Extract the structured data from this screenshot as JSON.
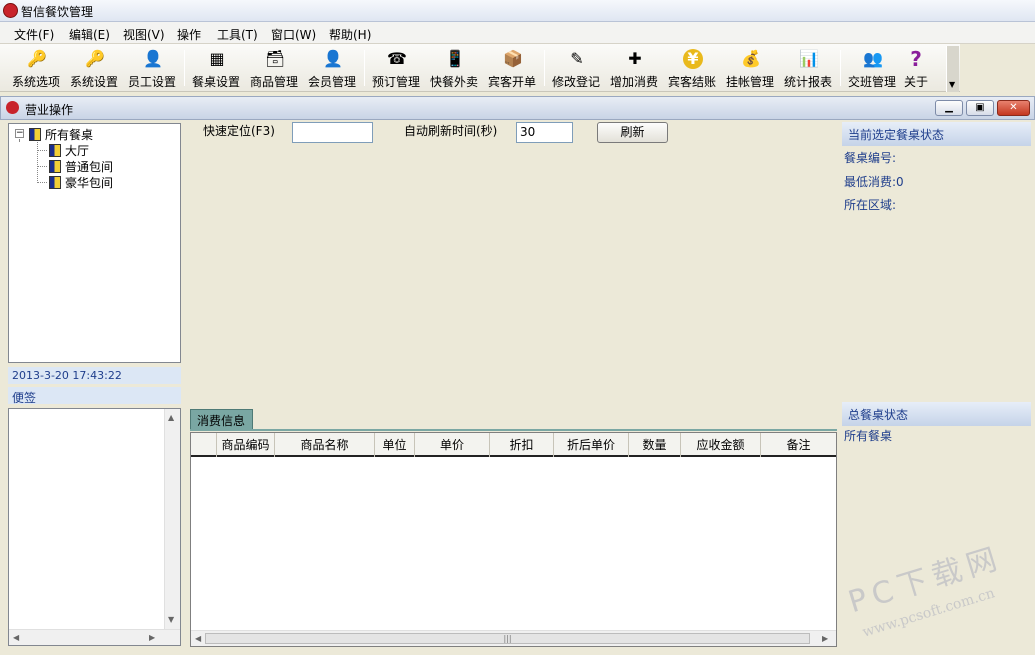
{
  "app": {
    "title": "智信餐饮管理"
  },
  "menu": [
    "文件(F)",
    "编辑(E)",
    "视图(V)",
    "操作",
    "工具(T)",
    "窗口(W)",
    "帮助(H)"
  ],
  "toolbar": [
    {
      "label": "系统选项",
      "icon": "key-icon",
      "glyph": "🔑"
    },
    {
      "label": "系统设置",
      "icon": "key-icon",
      "glyph": "🔑"
    },
    {
      "label": "员工设置",
      "icon": "user-icon",
      "glyph": "👤"
    },
    {
      "label": "餐桌设置",
      "icon": "table-icon",
      "glyph": "▦"
    },
    {
      "label": "商品管理",
      "icon": "box-icon",
      "glyph": "🗃"
    },
    {
      "label": "会员管理",
      "icon": "user-icon",
      "glyph": "👤"
    },
    {
      "label": "预订管理",
      "icon": "phone-icon",
      "glyph": "☎"
    },
    {
      "label": "快餐外卖",
      "icon": "mobile-icon",
      "glyph": "📱"
    },
    {
      "label": "宾客开单",
      "icon": "package-icon",
      "glyph": "📦"
    },
    {
      "label": "修改登记",
      "icon": "user-edit-icon",
      "glyph": "✎"
    },
    {
      "label": "增加消费",
      "icon": "add-icon",
      "glyph": "✚"
    },
    {
      "label": "宾客结账",
      "icon": "yen-icon",
      "glyph": "¥"
    },
    {
      "label": "挂帐管理",
      "icon": "moneybag-icon",
      "glyph": "💰"
    },
    {
      "label": "统计报表",
      "icon": "chart-icon",
      "glyph": "📊"
    },
    {
      "label": "交班管理",
      "icon": "users-icon",
      "glyph": "👥"
    },
    {
      "label": "关于",
      "icon": "help-icon",
      "glyph": "?"
    }
  ],
  "child_window": {
    "title": "营业操作"
  },
  "tree": {
    "root": "所有餐桌",
    "children": [
      "大厅",
      "普通包间",
      "豪华包间"
    ]
  },
  "datetime": "2013-3-20  17:43:22",
  "memo_label": "便签",
  "controls": {
    "quick_locate_label": "快速定位(F3)",
    "quick_locate_value": "",
    "auto_refresh_label": "自动刷新时间(秒)",
    "auto_refresh_value": "30",
    "refresh_button": "刷新"
  },
  "consume_tab": "消费信息",
  "grid_columns": [
    "商品编码",
    "商品名称",
    "单位",
    "单价",
    "折扣",
    "折后单价",
    "数量",
    "应收金额",
    "备注"
  ],
  "right_panel": {
    "current_header": "当前选定餐桌状态",
    "table_no_label": "餐桌编号:",
    "min_consume_label": "最低消费:0",
    "area_label": "所在区域:",
    "total_header": "总餐桌状态",
    "all_tables": "所有餐桌"
  },
  "watermark": {
    "big": "PC下载网",
    "small": "www.pcsoft.com.cn"
  },
  "colors": {
    "accent": "#1f3e8c",
    "tab": "#7aa7a3",
    "close": "#c4371f"
  }
}
